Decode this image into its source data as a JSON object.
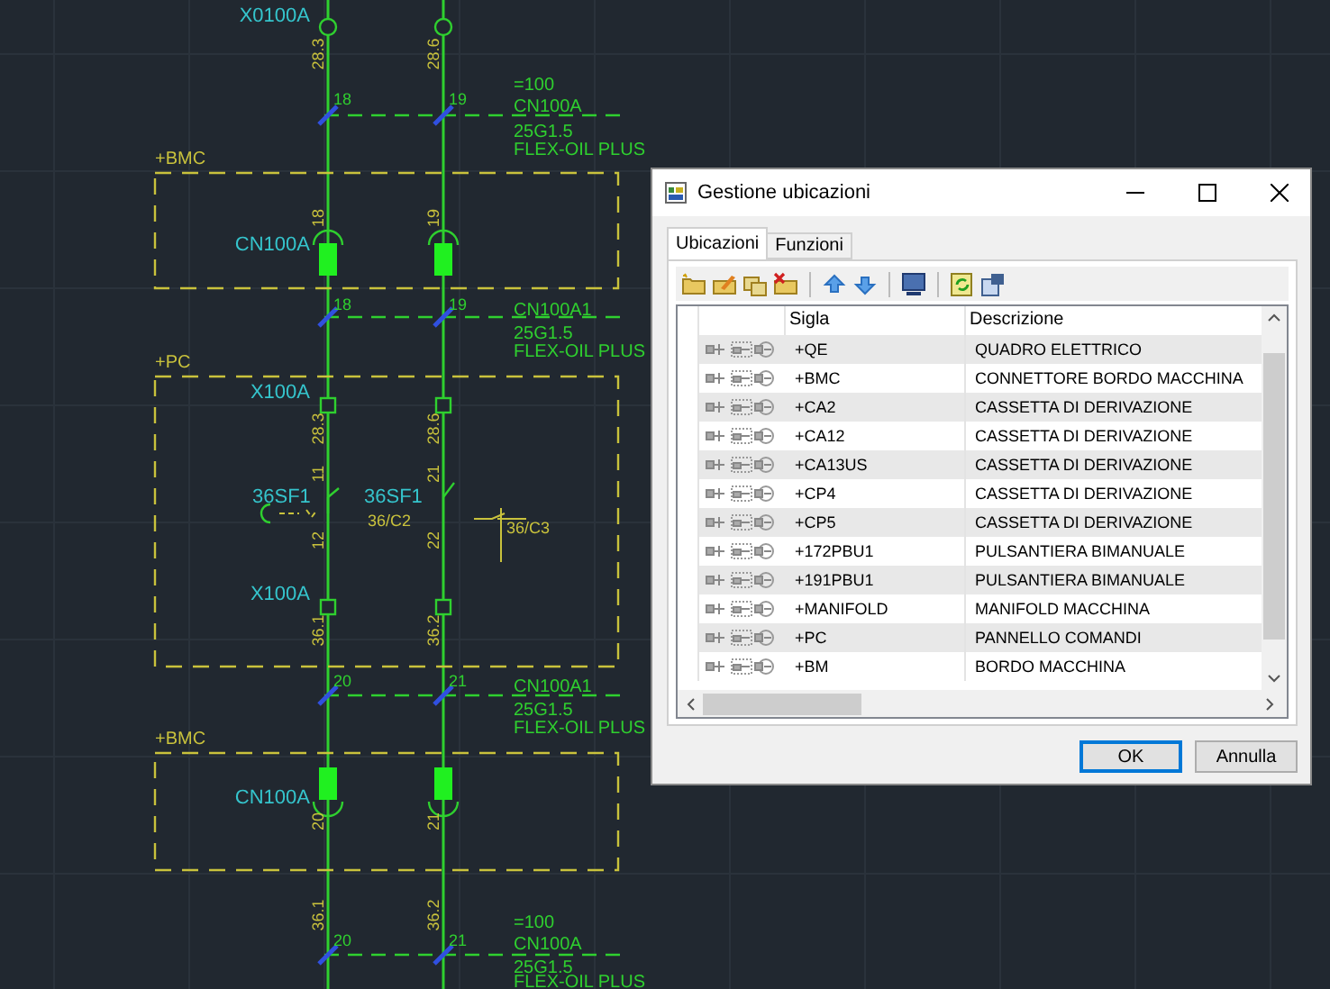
{
  "drawing": {
    "labels": [
      {
        "text": "X0100A",
        "kind": "ref"
      },
      {
        "text": "28.3",
        "kind": "wire"
      },
      {
        "text": "28.6",
        "kind": "wire"
      },
      {
        "text": "18",
        "kind": "terminal"
      },
      {
        "text": "19",
        "kind": "terminal"
      },
      {
        "text": "=100",
        "kind": "cable"
      },
      {
        "text": "CN100A",
        "kind": "cable"
      },
      {
        "text": "25G1.5",
        "kind": "cable"
      },
      {
        "text": "FLEX-OIL PLUS",
        "kind": "cable"
      },
      {
        "text": "+BMC",
        "kind": "location"
      },
      {
        "text": "18",
        "kind": "wire"
      },
      {
        "text": "19",
        "kind": "wire"
      },
      {
        "text": "CN100A",
        "kind": "ref"
      },
      {
        "text": "18",
        "kind": "terminal"
      },
      {
        "text": "19",
        "kind": "terminal"
      },
      {
        "text": "CN100A1",
        "kind": "cable"
      },
      {
        "text": "25G1.5",
        "kind": "cable"
      },
      {
        "text": "FLEX-OIL PLUS",
        "kind": "cable"
      },
      {
        "text": "+PC",
        "kind": "location"
      },
      {
        "text": "X100A",
        "kind": "ref"
      },
      {
        "text": "28.3",
        "kind": "wire"
      },
      {
        "text": "28.6",
        "kind": "wire"
      },
      {
        "text": "11",
        "kind": "wire"
      },
      {
        "text": "21",
        "kind": "wire"
      },
      {
        "text": "36SF1",
        "kind": "ref"
      },
      {
        "text": "36SF1",
        "kind": "ref"
      },
      {
        "text": "36/C2",
        "kind": "note"
      },
      {
        "text": "36/C3",
        "kind": "note"
      },
      {
        "text": "12",
        "kind": "wire"
      },
      {
        "text": "22",
        "kind": "wire"
      },
      {
        "text": "X100A",
        "kind": "ref"
      },
      {
        "text": "36.1",
        "kind": "wire"
      },
      {
        "text": "36.2",
        "kind": "wire"
      },
      {
        "text": "20",
        "kind": "terminal"
      },
      {
        "text": "21",
        "kind": "terminal"
      },
      {
        "text": "CN100A1",
        "kind": "cable"
      },
      {
        "text": "25G1.5",
        "kind": "cable"
      },
      {
        "text": "FLEX-OIL PLUS",
        "kind": "cable"
      },
      {
        "text": "+BMC",
        "kind": "location"
      },
      {
        "text": "CN100A",
        "kind": "ref"
      },
      {
        "text": "20",
        "kind": "wire"
      },
      {
        "text": "21",
        "kind": "wire"
      },
      {
        "text": "36.1",
        "kind": "wire"
      },
      {
        "text": "36.2",
        "kind": "wire"
      },
      {
        "text": "20",
        "kind": "terminal"
      },
      {
        "text": "21",
        "kind": "terminal"
      },
      {
        "text": "=100",
        "kind": "cable"
      },
      {
        "text": "CN100A",
        "kind": "cable"
      },
      {
        "text": "25G1.5",
        "kind": "cable"
      },
      {
        "text": "FLEX-OIL PLUS",
        "kind": "cable"
      }
    ]
  },
  "dialog": {
    "title": "Gestione ubicazioni",
    "tabs": [
      {
        "label": "Ubicazioni",
        "selected": true
      },
      {
        "label": "Funzioni",
        "selected": false
      }
    ],
    "table": {
      "columns": [
        "Sigla",
        "Descrizione"
      ],
      "rows": [
        {
          "sigla": "+QE",
          "descrizione": "QUADRO ELETTRICO"
        },
        {
          "sigla": "+BMC",
          "descrizione": "CONNETTORE BORDO MACCHINA"
        },
        {
          "sigla": "+CA2",
          "descrizione": "CASSETTA DI DERIVAZIONE"
        },
        {
          "sigla": "+CA12",
          "descrizione": "CASSETTA DI DERIVAZIONE"
        },
        {
          "sigla": "+CA13US",
          "descrizione": "CASSETTA DI DERIVAZIONE"
        },
        {
          "sigla": "+CP4",
          "descrizione": "CASSETTA DI DERIVAZIONE"
        },
        {
          "sigla": "+CP5",
          "descrizione": "CASSETTA DI DERIVAZIONE"
        },
        {
          "sigla": "+172PBU1",
          "descrizione": "PULSANTIERA BIMANUALE"
        },
        {
          "sigla": "+191PBU1",
          "descrizione": "PULSANTIERA BIMANUALE"
        },
        {
          "sigla": "+MANIFOLD",
          "descrizione": "MANIFOLD MACCHINA"
        },
        {
          "sigla": "+PC",
          "descrizione": "PANNELLO COMANDI"
        },
        {
          "sigla": "+BM",
          "descrizione": "BORDO MACCHINA"
        }
      ]
    },
    "buttons": [
      "OK",
      "Annulla"
    ]
  }
}
